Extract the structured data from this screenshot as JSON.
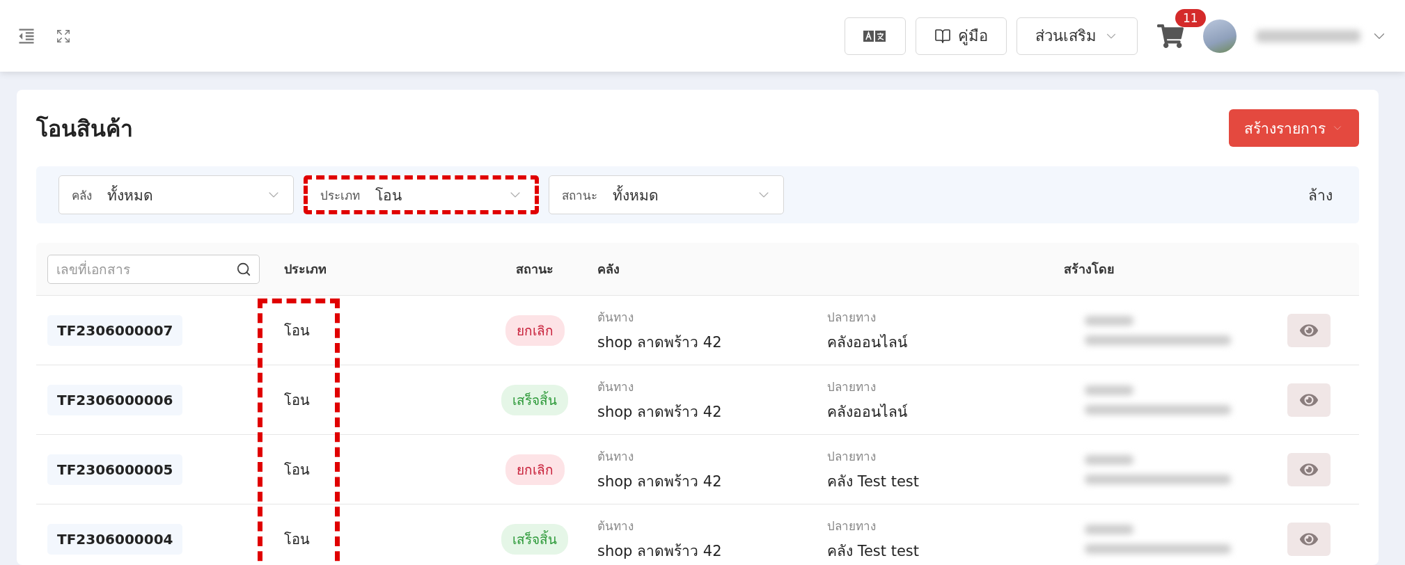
{
  "topbar": {
    "buttons": [
      {
        "kind": "translate"
      },
      {
        "kind": "manual",
        "label": "คู่มือ"
      },
      {
        "kind": "dropdown",
        "label": "ส่วนเสริม"
      }
    ],
    "cart_badge": "11"
  },
  "page": {
    "title": "โอนสินค้า",
    "create_button": "สร้างรายการ"
  },
  "filters": [
    {
      "label": "คลัง",
      "value": "ทั้งหมด",
      "highlighted": false
    },
    {
      "label": "ประเภท",
      "value": "โอน",
      "highlighted": true
    },
    {
      "label": "สถานะ",
      "value": "ทั้งหมด",
      "highlighted": false
    }
  ],
  "clear_button": "ล้าง",
  "table": {
    "search_placeholder": "เลขที่เอกสาร",
    "type_column_highlighted": true,
    "columns": [
      "ประเภท",
      "สถานะ",
      "คลัง",
      "สร้างโดย"
    ],
    "rows": [
      {
        "doc_no": "TF2306000007",
        "type": "โอน",
        "status": {
          "label": "ยกเลิก",
          "kind": "cancelled"
        },
        "origin_label": "ต้นทาง",
        "origin": "shop ลาดพร้าว 42",
        "dest_label": "ปลายทาง",
        "dest": "คลังออนไลน์"
      },
      {
        "doc_no": "TF2306000006",
        "type": "โอน",
        "status": {
          "label": "เสร็จสิ้น",
          "kind": "done"
        },
        "origin_label": "ต้นทาง",
        "origin": "shop ลาดพร้าว 42",
        "dest_label": "ปลายทาง",
        "dest": "คลังออนไลน์"
      },
      {
        "doc_no": "TF2306000005",
        "type": "โอน",
        "status": {
          "label": "ยกเลิก",
          "kind": "cancelled"
        },
        "origin_label": "ต้นทาง",
        "origin": "shop ลาดพร้าว 42",
        "dest_label": "ปลายทาง",
        "dest": "คลัง Test test"
      },
      {
        "doc_no": "TF2306000004",
        "type": "โอน",
        "status": {
          "label": "เสร็จสิ้น",
          "kind": "done"
        },
        "origin_label": "ต้นทาง",
        "origin": "shop ลาดพร้าว 42",
        "dest_label": "ปลายทาง",
        "dest": "คลัง Test test"
      }
    ]
  }
}
